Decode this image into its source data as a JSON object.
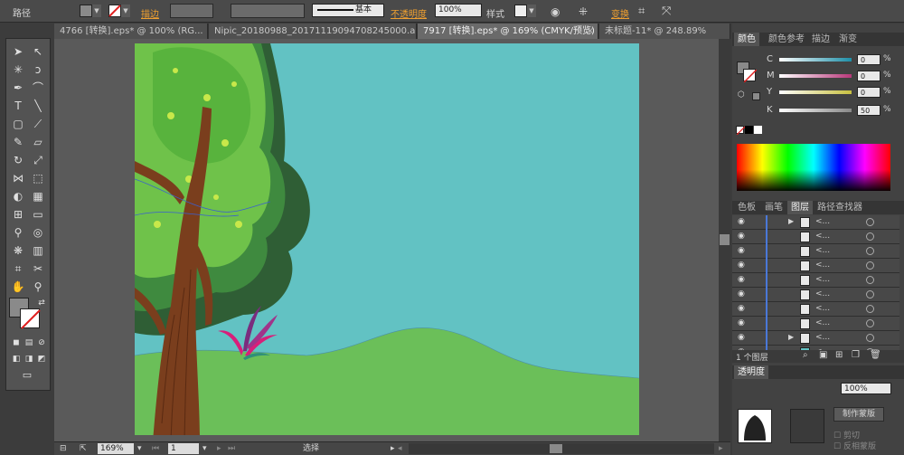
{
  "control_bar": {
    "path_label": "路径",
    "stroke_label": "描边",
    "stroke_profile": "基本",
    "opacity_label": "不透明度",
    "opacity_value": "100%",
    "style_label": "样式",
    "transform_label": "变换"
  },
  "tabs": [
    {
      "label": "4766 [转换].eps* @ 100% (RG...",
      "active": false
    },
    {
      "label": "Nipic_20180988_20171119094708245000.ai*",
      "active": false
    },
    {
      "label": "7917 [转换].eps* @ 169% (CMYK/预览)",
      "active": true
    },
    {
      "label": "未标题-11* @ 248.89%",
      "active": false
    }
  ],
  "status_bar": {
    "zoom": "169%",
    "page": "1",
    "tool_status": "选择"
  },
  "color_panel": {
    "tabs": [
      "颜色",
      "颜色参考",
      "描边",
      "渐变"
    ],
    "sliders": [
      {
        "channel": "C",
        "value": "0",
        "color": "#1e8fa8"
      },
      {
        "channel": "M",
        "value": "0",
        "color": "#b8387a"
      },
      {
        "channel": "Y",
        "value": "0",
        "color": "#c8c040"
      },
      {
        "channel": "K",
        "value": "50",
        "color": "#888888"
      }
    ],
    "percent": "%"
  },
  "layers_panel": {
    "tabs": [
      "色板",
      "画笔",
      "图层",
      "路径查找器"
    ],
    "rows": [
      "<...",
      "<...",
      "<...",
      "<...",
      "<...",
      "<...",
      "<...",
      "<...",
      "<...",
      "<..."
    ],
    "count_label": "1 个图层"
  },
  "transparency_panel": {
    "title": "透明度",
    "opacity_value": "100%",
    "make_mask_label": "制作蒙版",
    "clip_label": "剪切",
    "invert_mask_label": "反相蒙版"
  },
  "colors": {
    "artboard": "#62c2c3",
    "hill": "#6bbf59",
    "canvas_bg": "#5a5a5a"
  }
}
